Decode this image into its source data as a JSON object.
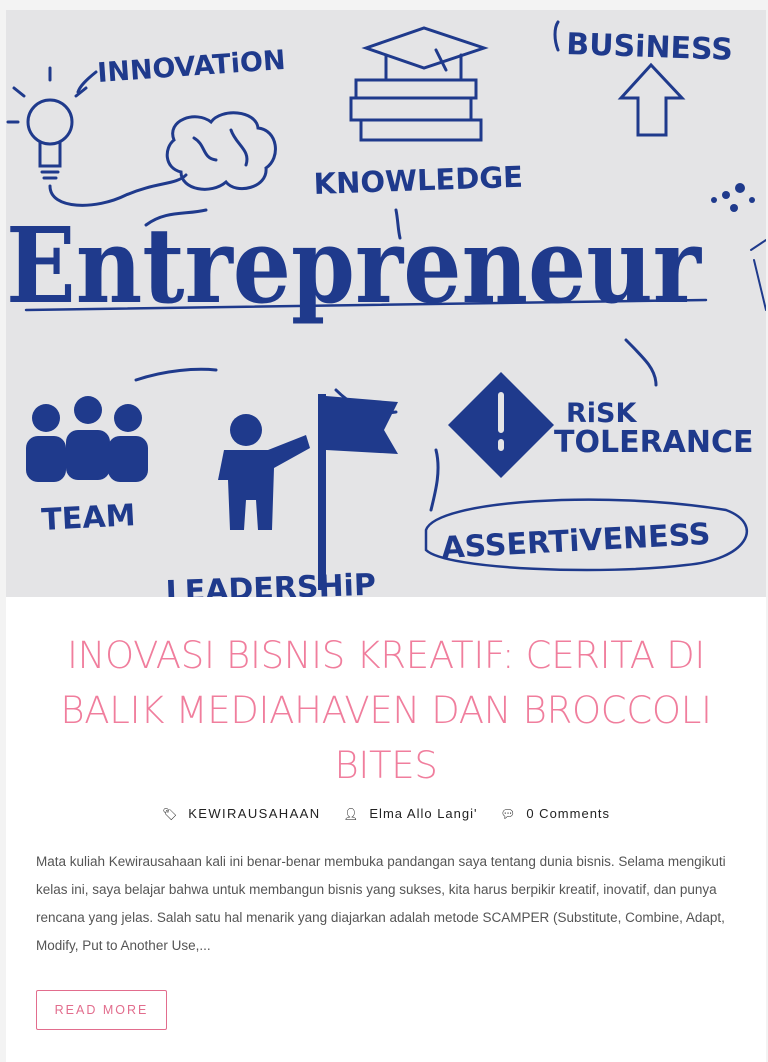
{
  "hero": {
    "words": {
      "innovation": "INNOVATiON",
      "business": "BUSiNESS",
      "knowledge": "KNOWLEDGE",
      "entrepreneur": "Entrepreneur",
      "risk": "RiSK",
      "tolerance": "TOLERANCE",
      "team": "TEAM",
      "assertiveness": "ASSERTiVENESS",
      "leadership": "LEADERSHiP"
    },
    "ink_color": "#1f3a8c"
  },
  "post": {
    "title": "INOVASI BISNIS KREATIF: CERITA DI BALIK MEDIAHAVEN DAN BROCCOLI BITES",
    "category": "KEWIRAUSAHAAN",
    "author": "Elma Allo Langi'",
    "comments": "0 Comments",
    "excerpt": " Mata kuliah Kewirausahaan kali ini benar-benar membuka pandangan saya tentang dunia bisnis. Selama mengikuti kelas ini, saya belajar bahwa untuk membangun bisnis yang sukses, kita harus berpikir kreatif, inovatif, dan punya rencana yang jelas. Salah satu hal menarik yang diajarkan adalah metode SCAMPER (Substitute, Combine, Adapt, Modify, Put to Another Use,...",
    "read_more": "READ MORE"
  },
  "icons": {
    "category": "tags-icon",
    "author": "user-icon",
    "comments": "comments-icon"
  },
  "colors": {
    "accent": "#f07e9d",
    "button": "#e26d8d"
  }
}
